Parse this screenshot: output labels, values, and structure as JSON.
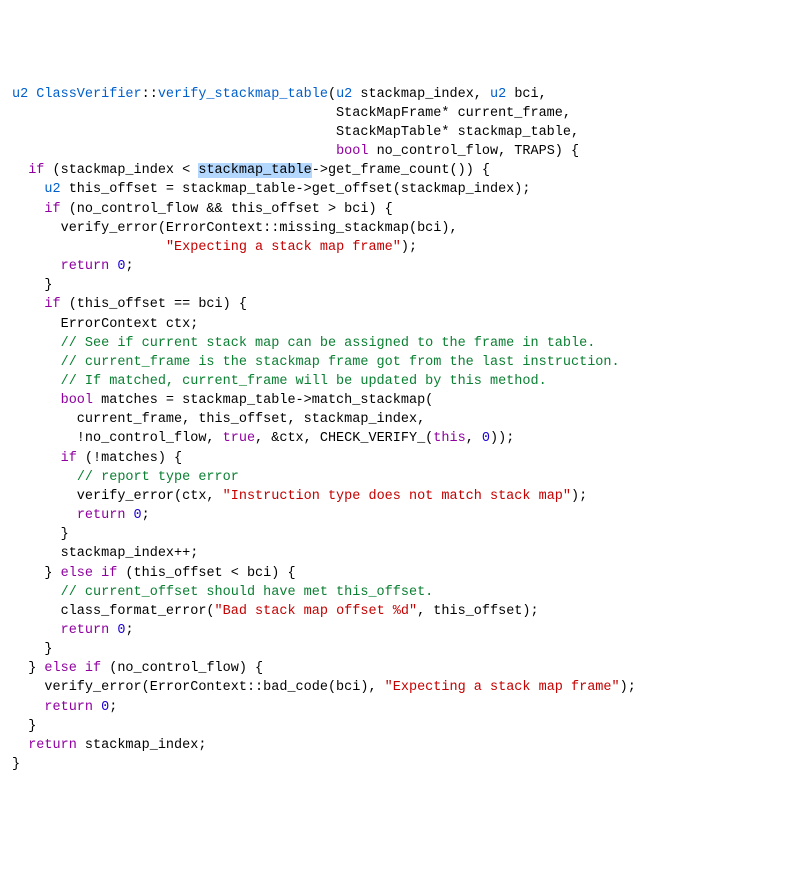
{
  "code": {
    "l1_a": "u2",
    "l1_b": " ClassVerifier",
    "l1_c": "::",
    "l1_d": "verify_stackmap_table",
    "l1_e": "(",
    "l1_f": "u2",
    "l1_g": " stackmap_index, ",
    "l1_h": "u2",
    "l1_i": " bci,",
    "l2_a": "                                        StackMapFrame* current_frame,",
    "l3_a": "                                        StackMapTable* stackmap_table,",
    "l4_a": "                                        ",
    "l4_b": "bool",
    "l4_c": " no_control_flow, TRAPS) {",
    "l5_a": "  ",
    "l5_b": "if",
    "l5_c": " (stackmap_index < ",
    "l5_d": "stackmap_table",
    "l5_e": "->get_frame_count()) {",
    "l6_a": "    ",
    "l6_b": "u2",
    "l6_c": " this_offset = stackmap_table->get_offset(stackmap_index);",
    "l7_a": "    ",
    "l7_b": "if",
    "l7_c": " (no_control_flow && this_offset > bci) {",
    "l8_a": "      verify_error(ErrorContext::missing_stackmap(bci),",
    "l9_a": "                   ",
    "l9_b": "\"Expecting a stack map frame\"",
    "l9_c": ");",
    "l10_a": "      ",
    "l10_b": "return",
    "l10_c": " ",
    "l10_d": "0",
    "l10_e": ";",
    "l11_a": "    }",
    "l12_a": "    ",
    "l12_b": "if",
    "l12_c": " (this_offset == bci) {",
    "l13_a": "      ErrorContext ctx;",
    "l14_a": "      ",
    "l14_b": "// See if current stack map can be assigned to the frame in table.",
    "l15_a": "      ",
    "l15_b": "// current_frame is the stackmap frame got from the last instruction.",
    "l16_a": "      ",
    "l16_b": "// If matched, current_frame will be updated by this method.",
    "l17_a": "      ",
    "l17_b": "bool",
    "l17_c": " matches = stackmap_table->match_stackmap(",
    "l18_a": "        current_frame, this_offset, stackmap_index,",
    "l19_a": "        !no_control_flow, ",
    "l19_b": "true",
    "l19_c": ", &ctx, CHECK_VERIFY_(",
    "l19_d": "this",
    "l19_e": ", ",
    "l19_f": "0",
    "l19_g": "));",
    "l20_a": "      ",
    "l20_b": "if",
    "l20_c": " (!matches) {",
    "l21_a": "        ",
    "l21_b": "// report type error",
    "l22_a": "        verify_error(ctx, ",
    "l22_b": "\"Instruction type does not match stack map\"",
    "l22_c": ");",
    "l23_a": "        ",
    "l23_b": "return",
    "l23_c": " ",
    "l23_d": "0",
    "l23_e": ";",
    "l24_a": "      }",
    "l25_a": "      stackmap_index++;",
    "l26_a": "    } ",
    "l26_b": "else",
    "l26_c": " ",
    "l26_d": "if",
    "l26_e": " (this_offset < bci) {",
    "l27_a": "      ",
    "l27_b": "// current_offset should have met this_offset.",
    "l28_a": "      class_format_error(",
    "l28_b": "\"Bad stack map offset %d\"",
    "l28_c": ", this_offset);",
    "l29_a": "      ",
    "l29_b": "return",
    "l29_c": " ",
    "l29_d": "0",
    "l29_e": ";",
    "l30_a": "    }",
    "l31_a": "  } ",
    "l31_b": "else",
    "l31_c": " ",
    "l31_d": "if",
    "l31_e": " (no_control_flow) {",
    "l32_a": "    verify_error(ErrorContext::bad_code(bci), ",
    "l32_b": "\"Expecting a stack map frame\"",
    "l32_c": ");",
    "l33_a": "    ",
    "l33_b": "return",
    "l33_c": " ",
    "l33_d": "0",
    "l33_e": ";",
    "l34_a": "  }",
    "l35_a": "  ",
    "l35_b": "return",
    "l35_c": " stackmap_index;",
    "l36_a": "}"
  }
}
